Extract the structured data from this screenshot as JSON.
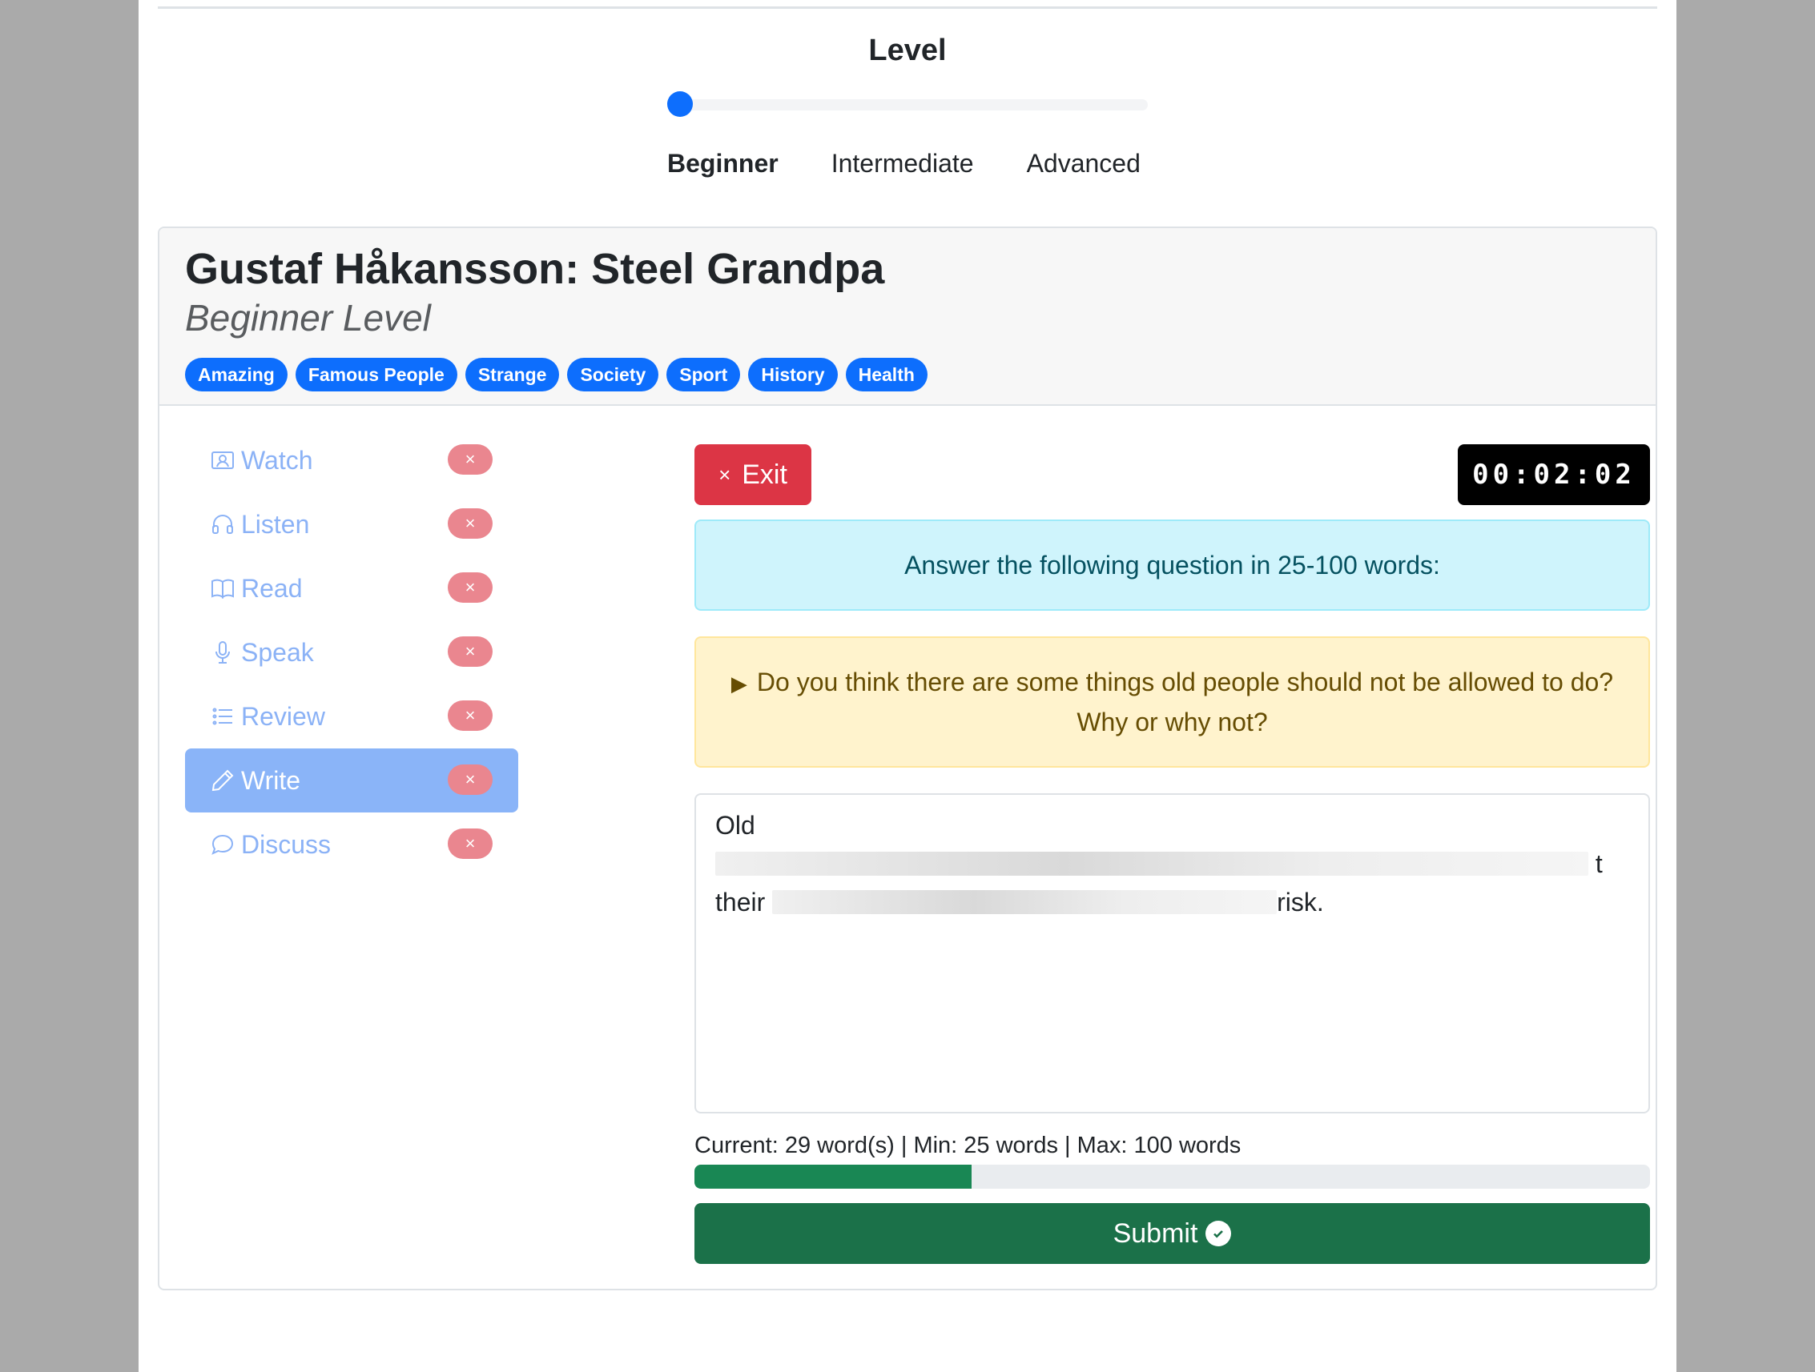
{
  "level": {
    "title": "Level",
    "slider_value": 0,
    "options": [
      {
        "label": "Beginner",
        "active": true
      },
      {
        "label": "Intermediate",
        "active": false
      },
      {
        "label": "Advanced",
        "active": false
      }
    ]
  },
  "lesson": {
    "title": "Gustaf Håkansson: Steel Grandpa",
    "subtitle": "Beginner Level",
    "tags": [
      "Amazing",
      "Famous People",
      "Strange",
      "Society",
      "Sport",
      "History",
      "Health"
    ]
  },
  "sidebar": {
    "items": [
      {
        "label": "Watch",
        "icon": "person-video-icon",
        "badge": "×",
        "active": false
      },
      {
        "label": "Listen",
        "icon": "headphones-icon",
        "badge": "×",
        "active": false
      },
      {
        "label": "Read",
        "icon": "book-icon",
        "badge": "×",
        "active": false
      },
      {
        "label": "Speak",
        "icon": "mic-icon",
        "badge": "×",
        "active": false
      },
      {
        "label": "Review",
        "icon": "list-icon",
        "badge": "×",
        "active": false
      },
      {
        "label": "Write",
        "icon": "pencil-icon",
        "badge": "×",
        "active": true
      },
      {
        "label": "Discuss",
        "icon": "chat-icon",
        "badge": "×",
        "active": false
      }
    ]
  },
  "exercise": {
    "exit_icon": "×",
    "exit_label": "Exit",
    "timer": "00:02:02",
    "instruction": "Answer the following question in 25-100 words:",
    "question": "Do you think there are some things old people should not be allowed to do? Why or why not?",
    "answer_line1_start": "Old",
    "answer_line1_end": "t",
    "answer_line2_start": "their",
    "answer_line2_end": "risk.",
    "word_count_text": "Current: 29 word(s) | Min: 25 words | Max: 100 words",
    "progress_fraction": 0.29,
    "submit_label": "Submit"
  },
  "colors": {
    "primary": "#0d6efd",
    "danger": "#dc3545",
    "success": "#198754",
    "submit": "#1b7149"
  }
}
